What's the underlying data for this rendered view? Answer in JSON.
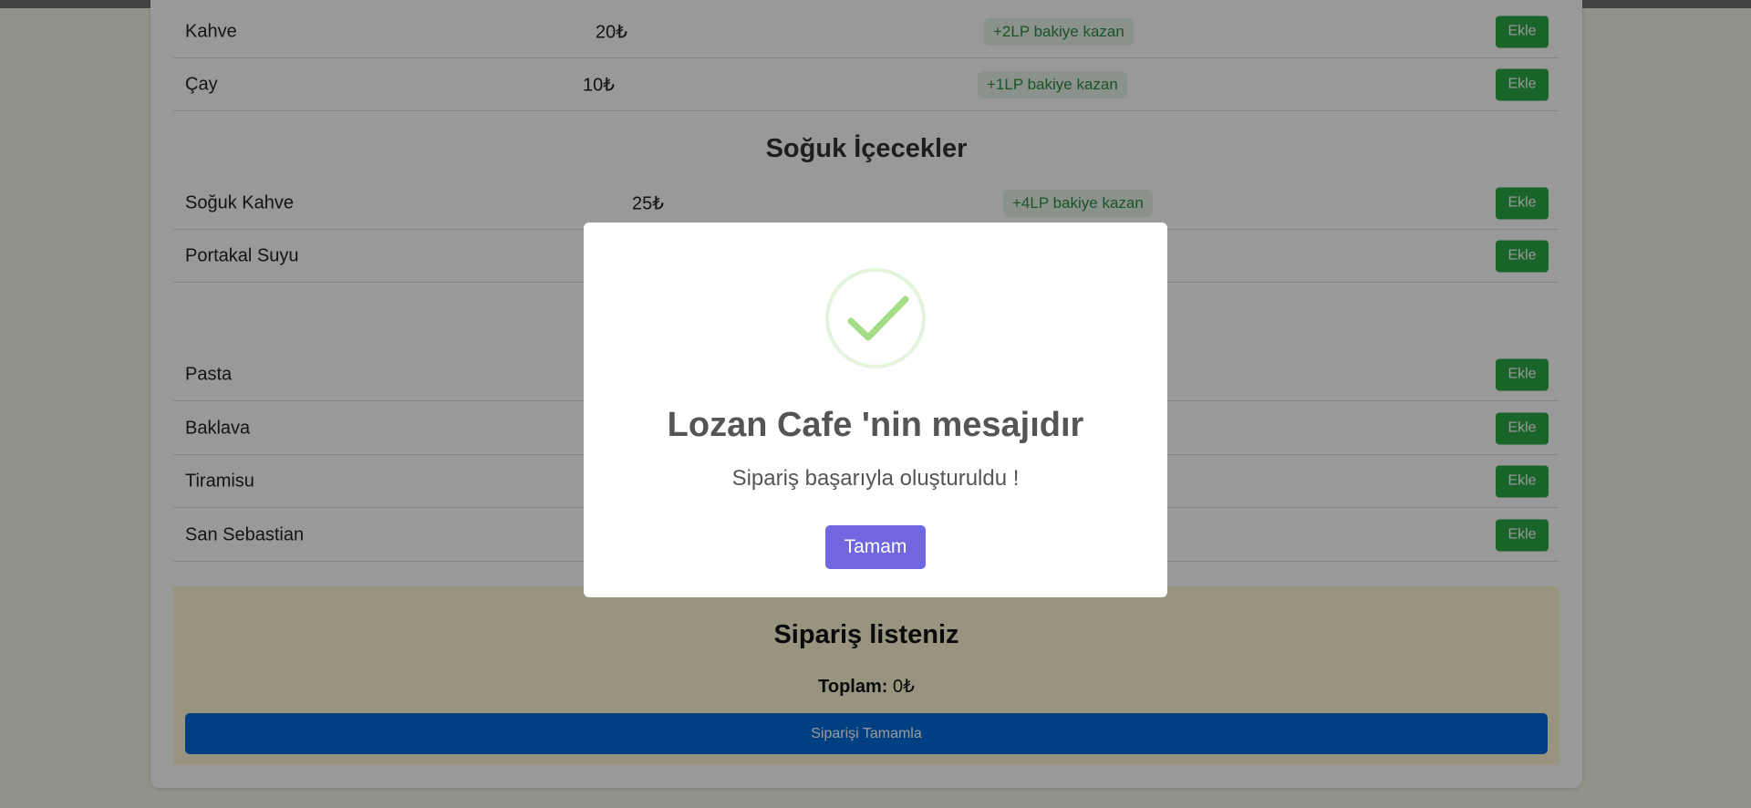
{
  "menu": {
    "sections": [
      {
        "title": "",
        "items": [
          {
            "name": "Kahve",
            "price": "20₺",
            "lp": "+2LP bakiye kazan",
            "add_label": "Ekle"
          },
          {
            "name": "Çay",
            "price": "10₺",
            "lp": "+1LP bakiye kazan",
            "add_label": "Ekle"
          }
        ]
      },
      {
        "title": "Soğuk İçecekler",
        "items": [
          {
            "name": "Soğuk Kahve",
            "price": "25₺",
            "lp": "+4LP bakiye kazan",
            "add_label": "Ekle"
          },
          {
            "name": "Portakal Suyu",
            "add_label": "Ekle"
          }
        ]
      },
      {
        "title": "",
        "items": [
          {
            "name": "Pasta",
            "add_label": "Ekle"
          },
          {
            "name": "Baklava",
            "add_label": "Ekle"
          },
          {
            "name": "Tiramisu",
            "add_label": "Ekle"
          },
          {
            "name": "San Sebastian",
            "add_label": "Ekle"
          }
        ]
      }
    ]
  },
  "order": {
    "title": "Sipariş listeniz",
    "total_label": "Toplam:",
    "total_value": "0₺",
    "complete_label": "Siparişi Tamamla"
  },
  "modal": {
    "icon": "success-check-icon",
    "title": "Lozan Cafe 'nin mesajıdır",
    "text": "Sipariş başarıyla oluşturuldu !",
    "confirm_label": "Tamam"
  },
  "colors": {
    "add_button": "#28a745",
    "complete_button": "#0069d9",
    "confirm_button": "#7066e0",
    "lp_badge_bg": "#e6f4e8",
    "lp_badge_text": "#2e8b44",
    "order_box_bg": "#fff7d6",
    "success_icon": "#a5dc86"
  }
}
